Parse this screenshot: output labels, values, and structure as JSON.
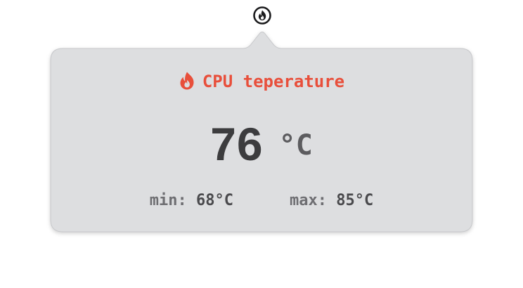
{
  "menubar": {
    "icon": "flame-circle-icon"
  },
  "popover": {
    "title": "CPU teperature",
    "title_icon": "flame-icon",
    "title_color": "#e84f3b",
    "current_value": "76",
    "unit": "°C",
    "min_label": "min:",
    "min_value": "68°C",
    "max_label": "max:",
    "max_value": "85°C"
  }
}
